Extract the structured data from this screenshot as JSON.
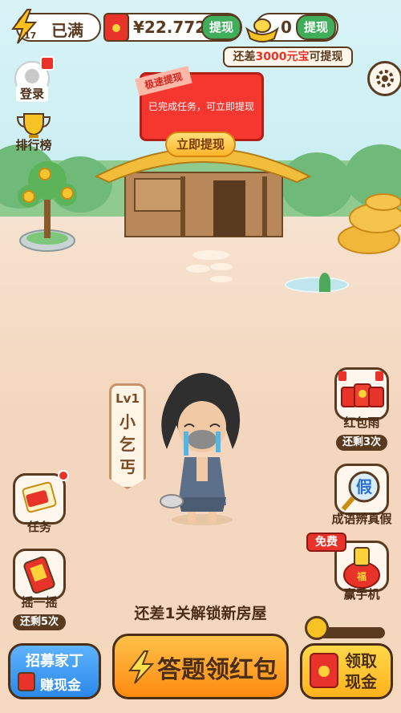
{
  "energy": {
    "level": "17",
    "status": "已满"
  },
  "balance": {
    "amount": "¥22.772",
    "withdraw_label": "提现"
  },
  "ingot": {
    "count": "0",
    "withdraw_label": "提现"
  },
  "hint": {
    "prefix": "还差",
    "amount": "3000元宝",
    "suffix": "可提现"
  },
  "left_menu": {
    "login": "登录",
    "ranking": "排行榜"
  },
  "popup": {
    "badge": "极速提现",
    "message": "已完成任务，可立即提现",
    "button": "立即提现"
  },
  "character": {
    "level": "Lv1",
    "name": "小乞丐"
  },
  "right_menu": {
    "red_rain": "红包雨",
    "red_rain_remaining": "还剩3次",
    "idiom": "成语辨真假",
    "free_badge": "免费",
    "phone": "赢手机",
    "fu": "福",
    "jia": "假"
  },
  "task": {
    "label": "任务"
  },
  "shake": {
    "label": "摇一摇",
    "remaining": "还剩5次"
  },
  "unlock_text": "还差1关解锁新房屋",
  "bottom": {
    "recruit": "招募家丁",
    "earn": "赚现金",
    "answer": "答题领红包",
    "claim_line1": "领取",
    "claim_line2": "现金"
  },
  "colors": {
    "accent_orange": "#ff9a1f",
    "brand_red": "#e8332a",
    "green": "#3fae5a",
    "blue": "#2b88e8"
  }
}
